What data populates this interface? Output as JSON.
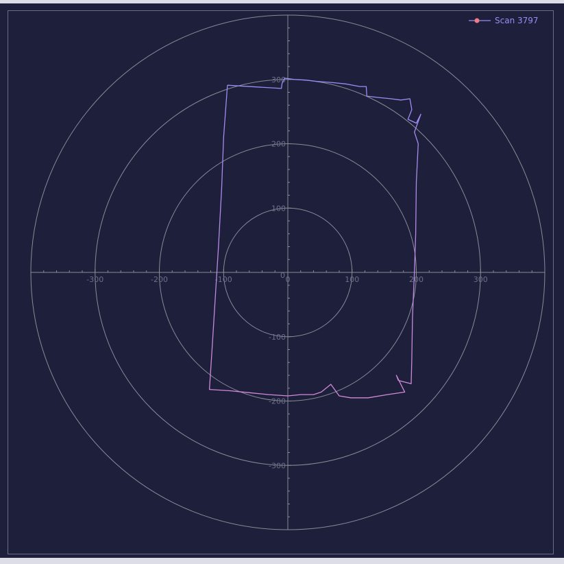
{
  "chart_data": {
    "type": "scatter",
    "projection": "polar-cartesian",
    "xlim": [
      -400,
      400
    ],
    "ylim": [
      -400,
      400
    ],
    "ring_radii": [
      100,
      200,
      300,
      400
    ],
    "x_ticks": [
      -300,
      -200,
      -100,
      0,
      100,
      200,
      300
    ],
    "y_ticks": [
      -300,
      -200,
      -100,
      100,
      200,
      300
    ],
    "grid": true,
    "legend_position": "top-right",
    "colors": {
      "background": "#1e1f3b",
      "grid": "#8a8b96",
      "axis_text": "#6e7088",
      "line_start": "#9a8cf6",
      "line_end": "#d38ad8",
      "marker": "#ef7b86",
      "legend_text": "#9a8cf6"
    },
    "series": [
      {
        "name": "Scan 3797",
        "points": [
          [
            -94,
            291
          ],
          [
            -10,
            286
          ],
          [
            -9,
            294
          ],
          [
            -5,
            302
          ],
          [
            10,
            300
          ],
          [
            28,
            299
          ],
          [
            45,
            297
          ],
          [
            70,
            295
          ],
          [
            90,
            293
          ],
          [
            112,
            289
          ],
          [
            122,
            289
          ],
          [
            123,
            274
          ],
          [
            140,
            272
          ],
          [
            160,
            270
          ],
          [
            176,
            268
          ],
          [
            190,
            270
          ],
          [
            193,
            253
          ],
          [
            187,
            238
          ],
          [
            200,
            232
          ],
          [
            207,
            246
          ],
          [
            197,
            218
          ],
          [
            203,
            200
          ],
          [
            200,
            140
          ],
          [
            199,
            60
          ],
          [
            197,
            0
          ],
          [
            194,
            -70
          ],
          [
            193,
            -135
          ],
          [
            192,
            -173
          ],
          [
            172,
            -168
          ],
          [
            169,
            -160
          ],
          [
            182,
            -186
          ],
          [
            155,
            -190
          ],
          [
            125,
            -195
          ],
          [
            98,
            -195
          ],
          [
            80,
            -192
          ],
          [
            67,
            -174
          ],
          [
            52,
            -186
          ],
          [
            40,
            -190
          ],
          [
            20,
            -190
          ],
          [
            0,
            -192
          ],
          [
            -30,
            -190
          ],
          [
            -60,
            -187
          ],
          [
            -90,
            -184
          ],
          [
            -122,
            -182
          ],
          [
            -118,
            -120
          ],
          [
            -113,
            -40
          ],
          [
            -108,
            40
          ],
          [
            -103,
            130
          ],
          [
            -100,
            210
          ],
          [
            -94,
            291
          ]
        ]
      }
    ]
  }
}
